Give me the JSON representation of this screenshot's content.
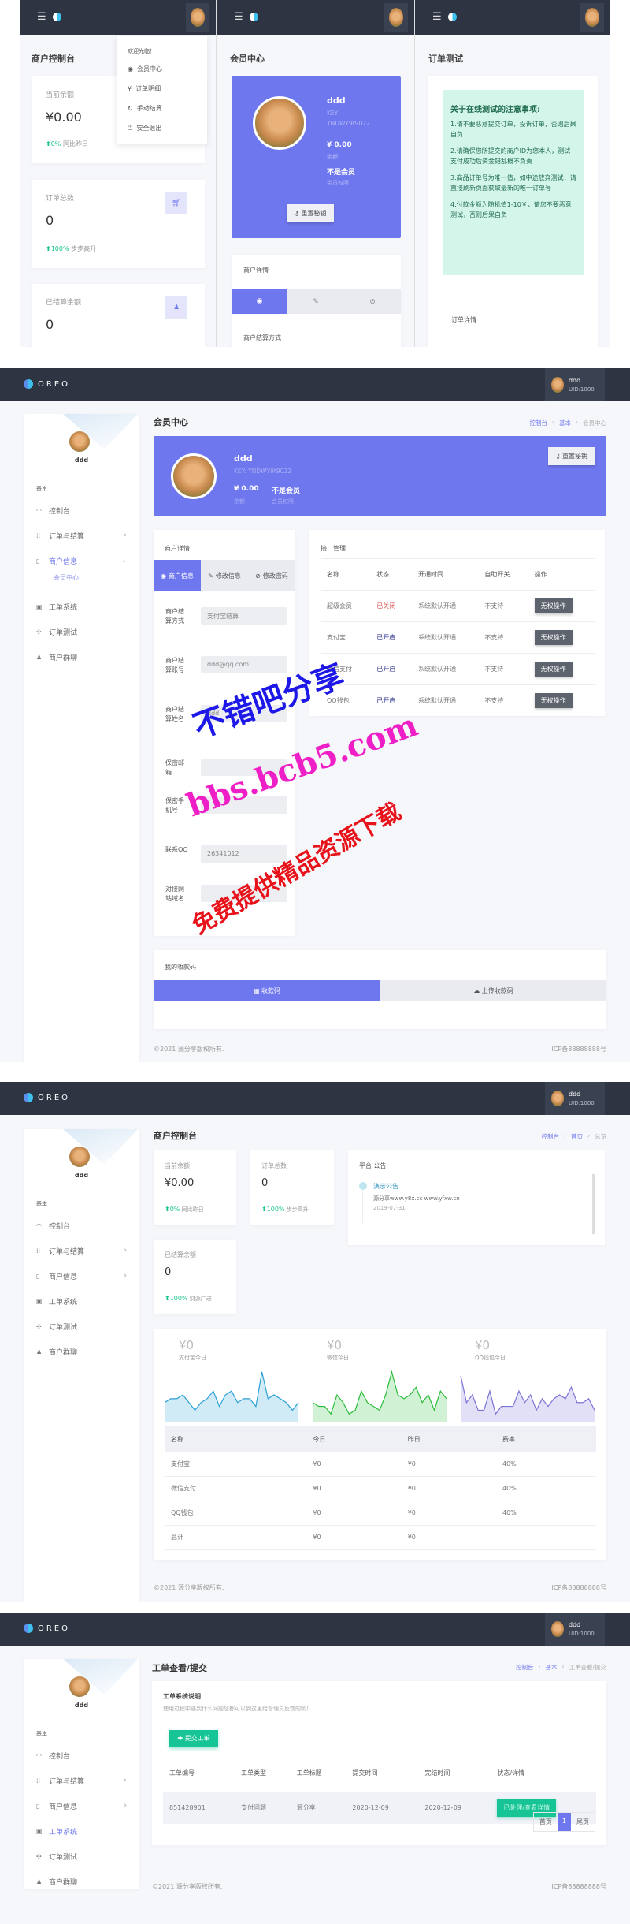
{
  "brand": "OREO",
  "user": {
    "name": "ddd",
    "uid": "UID:1000",
    "key": "KEY: YNDWY9t9022",
    "key_label": "KEY",
    "key_value": "YNDWY9t9022"
  },
  "colors": {
    "header": "#2e3441",
    "accent": "#6e77ee",
    "success": "#19c48f",
    "danger": "#d9534f",
    "notice_bg": "#d4f5ea"
  },
  "sidebar": {
    "group": "基本",
    "items": [
      {
        "label": "控制台",
        "icon": "dashboard-icon",
        "glyph": "◠"
      },
      {
        "label": "订单与结算",
        "icon": "grid-icon",
        "glyph": "⁞⁞",
        "chevron": "›"
      },
      {
        "label": "商户信息",
        "icon": "clipboard-icon",
        "glyph": "▯",
        "chevron": "›"
      },
      {
        "label": "工单系统",
        "icon": "ticket-icon",
        "glyph": "▣"
      },
      {
        "label": "订单测试",
        "icon": "test-icon",
        "glyph": "✣"
      },
      {
        "label": "商户群聊",
        "icon": "users-icon",
        "glyph": "♟"
      }
    ],
    "sub_member": "会员中心",
    "chevron_down": "⌄"
  },
  "mobile": {
    "dropdown": {
      "welcome": "欢迎光临！",
      "items": [
        "会员中心",
        "订单明细",
        "手动结算",
        "安全退出"
      ],
      "glyphs": [
        "◉",
        "¥",
        "↻",
        "⏻"
      ]
    },
    "p1": {
      "title": "商户控制台"
    },
    "p2": {
      "title": "会员中心",
      "details_title": "商户详情",
      "settle_label": "商户结算方式"
    },
    "p3": {
      "title": "订单测试",
      "notice_title": "关于在线测试的注意事项:",
      "notices": [
        "1.请不要恶意提交订单，投诉订单，否则后果自负",
        "2.请确保您所提交的商户ID为您本人，测试支付成功后资金错乱概不负责",
        "3.商品订单号为唯一值，如中途放弃测试，请直接刷新页面获取最新的唯一订单号",
        "4.付款金额为随机值1-10￥，请您不要恶意测试，否则后果自负"
      ],
      "order_details": "订单详情"
    }
  },
  "stats": {
    "balance_label": "当前余额",
    "balance": "¥0.00",
    "balance_change": "0%",
    "balance_note": "同比昨日",
    "orders_label": "订单总数",
    "orders": "0",
    "orders_change": "100%",
    "orders_note": "步步高升",
    "settled_label": "已结算余额",
    "settled": "0",
    "settled_change": "100%",
    "settled_note": "财源广进"
  },
  "member": {
    "title": "会员中心",
    "breadcrumb": [
      "控制台",
      "基本",
      "会员中心"
    ],
    "balance": "¥ 0.00",
    "balance_label": "余额",
    "membership": "不是会员",
    "membership_label": "会员权限",
    "reset_key": "重置秘钥",
    "details": {
      "title": "商户详情",
      "tabs": [
        "商户信息",
        "修改信息",
        "修改密码"
      ],
      "fields": [
        {
          "label": "商户结算方式",
          "value": "支付宝结算"
        },
        {
          "label": "商户结算账号",
          "value": "ddd@qq.com"
        },
        {
          "label": "商户结算姓名",
          "value": "ddd"
        },
        {
          "label": "保密邮箱",
          "value": ""
        },
        {
          "label": "保密手机号",
          "value": ""
        },
        {
          "label": "联系QQ",
          "value": "26341012"
        },
        {
          "label": "对接网站域名",
          "value": ""
        }
      ]
    },
    "api": {
      "title": "接口管理",
      "columns": [
        "名称",
        "状态",
        "开通时间",
        "自助开关",
        "操作"
      ],
      "rows": [
        {
          "name": "超级会员",
          "status": "已关闭",
          "opened": "系统默认开通",
          "self": "不支持",
          "action": "无权操作"
        },
        {
          "name": "支付宝",
          "status": "已开启",
          "opened": "系统默认开通",
          "self": "不支持",
          "action": "无权操作"
        },
        {
          "name": "微信支付",
          "status": "已开启",
          "opened": "系统默认开通",
          "self": "不支持",
          "action": "无权操作"
        },
        {
          "name": "QQ钱包",
          "status": "已开启",
          "opened": "系统默认开通",
          "self": "不支持",
          "action": "无权操作"
        }
      ]
    },
    "qr": {
      "title": "我的收款码",
      "tabs": [
        "收款码",
        "上传收款码"
      ]
    }
  },
  "dashboard": {
    "title": "商户控制台",
    "breadcrumb": [
      "控制台",
      "首页",
      "总览"
    ],
    "notice": {
      "title": "平台 公告",
      "item_title": "演示公告",
      "item_text": "源分享www.y8x.cc www.yfxw.cn",
      "item_date": "2019-07-31"
    },
    "today": [
      {
        "value": "¥0",
        "label": "支付宝今日"
      },
      {
        "value": "¥0",
        "label": "微信今日"
      },
      {
        "value": "¥0",
        "label": "QQ钱包今日"
      }
    ],
    "table": {
      "columns": [
        "名称",
        "今日",
        "昨日",
        "费率"
      ],
      "rows": [
        [
          "支付宝",
          "¥0",
          "¥0",
          "40%"
        ],
        [
          "微信支付",
          "¥0",
          "¥0",
          "40%"
        ],
        [
          "QQ钱包",
          "¥0",
          "¥0",
          "40%"
        ],
        [
          "总计",
          "¥0",
          "¥0",
          ""
        ]
      ]
    }
  },
  "chart_data": {
    "type": "area",
    "series": [
      {
        "color": "#2a9fd6",
        "values": [
          5,
          6,
          6,
          7,
          5,
          3,
          5,
          6,
          8,
          4,
          7,
          8,
          5,
          6,
          6,
          4,
          13,
          6,
          7,
          6,
          5,
          3,
          5
        ]
      },
      {
        "color": "#2bbd3a",
        "values": [
          5,
          4,
          4,
          2,
          7,
          5,
          2,
          3,
          8,
          5,
          4,
          3,
          7,
          13,
          7,
          6,
          7,
          9,
          5,
          7,
          3,
          8,
          6
        ]
      },
      {
        "color": "#7b74d6",
        "values": [
          12,
          5,
          7,
          3,
          3,
          8,
          2,
          4,
          4,
          4,
          8,
          5,
          7,
          3,
          6,
          4,
          6,
          7,
          6,
          9,
          5,
          5,
          6,
          3
        ]
      }
    ]
  },
  "tickets": {
    "title": "工单查看/提交",
    "breadcrumb": [
      "控制台",
      "基本",
      "工单查看/提交"
    ],
    "info_title": "工单系统说明",
    "info_text": "使用过程中遇到什么问题您都可以到这里给管理员反馈的哟！",
    "submit": "提交工单",
    "columns": [
      "工单编号",
      "工单类型",
      "工单标题",
      "提交时间",
      "完结时间",
      "状态/详情"
    ],
    "rows": [
      {
        "id": "851428901",
        "type": "支付问题",
        "title": "源分享",
        "submitted": "2020-12-09",
        "closed": "2020-12-09",
        "status": "已处理/查看详情"
      }
    ],
    "pagination": {
      "first": "首页",
      "current": "1",
      "last": "尾页"
    }
  },
  "footer": {
    "copyright": "©2021 源分享版权所有.",
    "icp": "ICP备88888888号"
  },
  "watermark": {
    "line1": "不错吧分享",
    "line2": "bbs.bcb5.com",
    "line3": "免费提供精品资源下载"
  }
}
